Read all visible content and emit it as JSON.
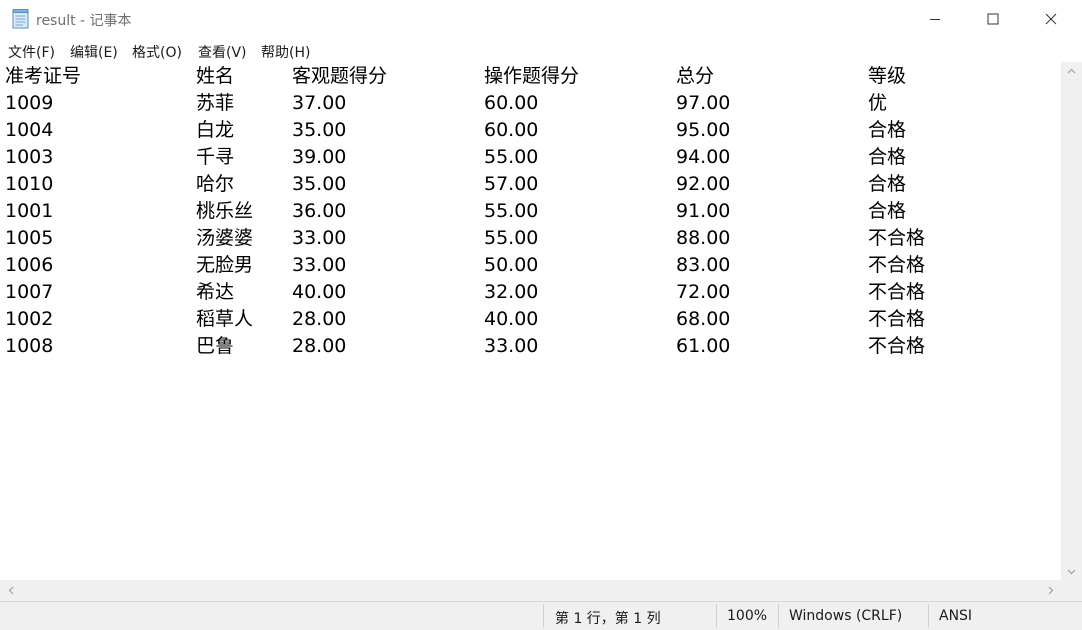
{
  "window": {
    "title": "result - 记事本",
    "icon": "notepad-icon"
  },
  "menu": [
    {
      "label": "文件(F)"
    },
    {
      "label": "编辑(E)"
    },
    {
      "label": "格式(O)"
    },
    {
      "label": "查看(V)"
    },
    {
      "label": "帮助(H)"
    }
  ],
  "document": {
    "header": [
      "准考证号",
      "姓名",
      "客观题得分",
      "操作题得分",
      "总分",
      "等级"
    ],
    "rows": [
      [
        "1009",
        "苏菲",
        "37.00",
        "60.00",
        "97.00",
        "优"
      ],
      [
        "1004",
        "白龙",
        "35.00",
        "60.00",
        "95.00",
        "合格"
      ],
      [
        "1003",
        "千寻",
        "39.00",
        "55.00",
        "94.00",
        "合格"
      ],
      [
        "1010",
        "哈尔",
        "35.00",
        "57.00",
        "92.00",
        "合格"
      ],
      [
        "1001",
        "桃乐丝",
        "36.00",
        "55.00",
        "91.00",
        "合格"
      ],
      [
        "1005",
        "汤婆婆",
        "33.00",
        "55.00",
        "88.00",
        "不合格"
      ],
      [
        "1006",
        "无脸男",
        "33.00",
        "50.00",
        "83.00",
        "不合格"
      ],
      [
        "1007",
        "希达",
        "40.00",
        "32.00",
        "72.00",
        "不合格"
      ],
      [
        "1002",
        "稻草人",
        "28.00",
        "40.00",
        "68.00",
        "不合格"
      ],
      [
        "1008",
        "巴鲁",
        "28.00",
        "33.00",
        "61.00",
        "不合格"
      ]
    ]
  },
  "status": {
    "position": "第 1 行，第 1 列",
    "zoom": "100%",
    "line_ending": "Windows (CRLF)",
    "encoding": "ANSI"
  }
}
